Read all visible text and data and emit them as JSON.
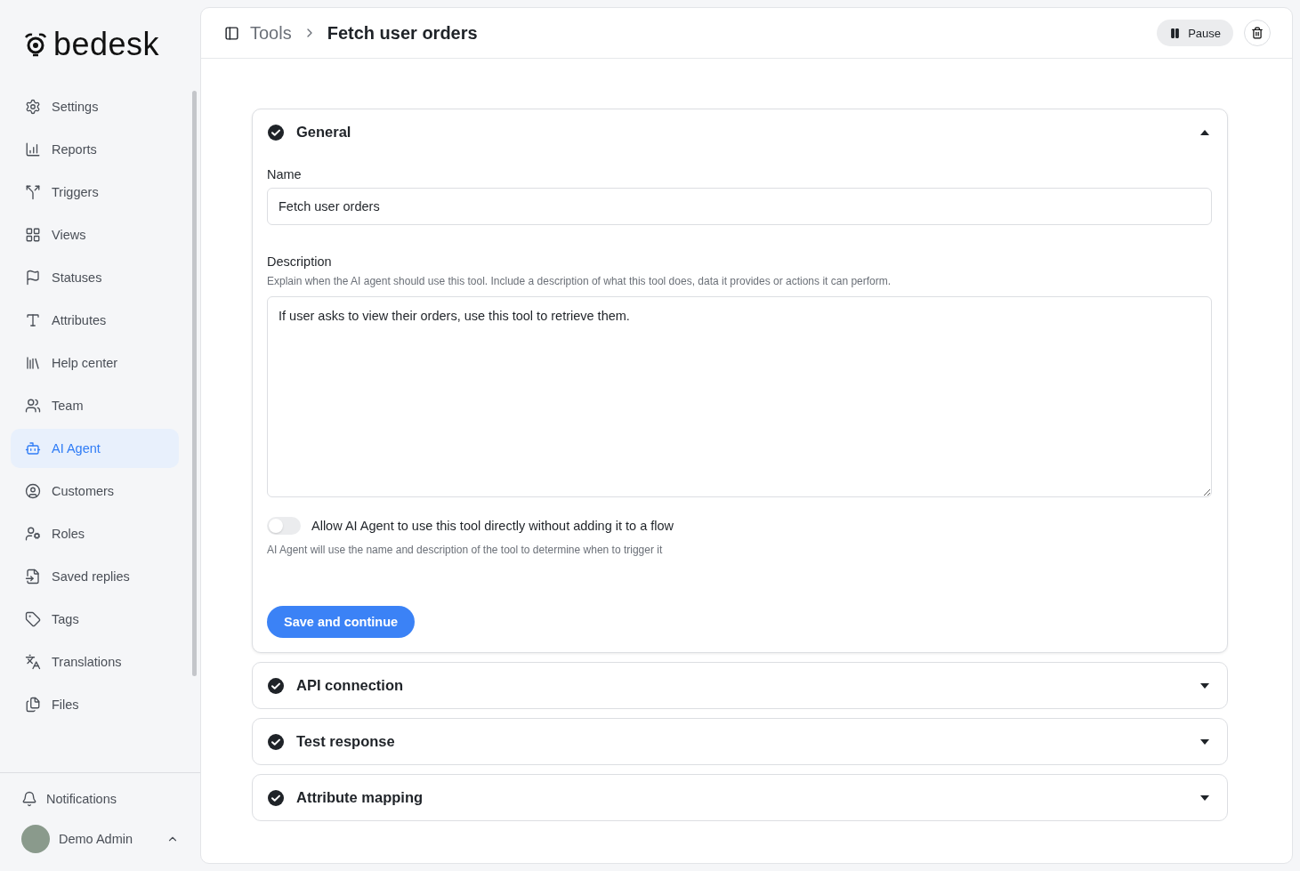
{
  "brand": {
    "name": "bedesk"
  },
  "sidebar": {
    "items": [
      {
        "label": "Settings",
        "selected": false
      },
      {
        "label": "Reports",
        "selected": false
      },
      {
        "label": "Triggers",
        "selected": false
      },
      {
        "label": "Views",
        "selected": false
      },
      {
        "label": "Statuses",
        "selected": false
      },
      {
        "label": "Attributes",
        "selected": false
      },
      {
        "label": "Help center",
        "selected": false
      },
      {
        "label": "Team",
        "selected": false
      },
      {
        "label": "AI Agent",
        "selected": true
      },
      {
        "label": "Customers",
        "selected": false
      },
      {
        "label": "Roles",
        "selected": false
      },
      {
        "label": "Saved replies",
        "selected": false
      },
      {
        "label": "Tags",
        "selected": false
      },
      {
        "label": "Translations",
        "selected": false
      },
      {
        "label": "Files",
        "selected": false
      }
    ],
    "notifications": "Notifications",
    "user": {
      "name": "Demo Admin"
    }
  },
  "header": {
    "breadcrumb": [
      "Tools",
      "Fetch user orders"
    ],
    "pause_button": "Pause"
  },
  "sections": [
    {
      "title": "General",
      "expanded": true
    },
    {
      "title": "API connection",
      "expanded": false
    },
    {
      "title": "Test response",
      "expanded": false
    },
    {
      "title": "Attribute mapping",
      "expanded": false
    }
  ],
  "general": {
    "name_label": "Name",
    "name_value": "Fetch user orders",
    "description_label": "Description",
    "description_hint": "Explain when the AI agent should use this tool. Include a description of what this tool does, data it provides or actions it can perform.",
    "description_value": "If user asks to view their orders, use this tool to retrieve them.",
    "toggle": {
      "label": "Allow AI Agent to use this tool directly without adding it to a flow",
      "on": false
    },
    "toggle_hint": "AI Agent will use the name and description of the tool to determine when to trigger it",
    "save_button": "Save and continue"
  }
}
